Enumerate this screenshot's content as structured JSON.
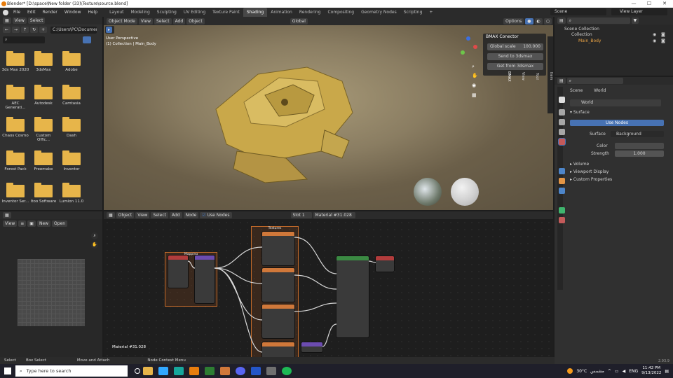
{
  "window": {
    "title": "Blender* [D:\\space\\New folder (33)\\Texture\\source.blend]",
    "min": "—",
    "max": "☐",
    "close": "✕"
  },
  "menu": [
    "File",
    "Edit",
    "Render",
    "Window",
    "Help"
  ],
  "workspaces": [
    "Layout",
    "Modeling",
    "Sculpting",
    "UV Editing",
    "Texture Paint",
    "Shading",
    "Animation",
    "Rendering",
    "Compositing",
    "Geometry Nodes",
    "Scripting",
    "+"
  ],
  "active_workspace": "Shading",
  "scene": {
    "label": "Scene",
    "view_layer": "View Layer"
  },
  "file_browser": {
    "path": "C:\\Users\\PC\\Documents\\",
    "folders": [
      "3ds Max 2020",
      "3dsMax",
      "Adobe",
      "AEC Generati...",
      "Autodesk",
      "Camtasia",
      "Chaos Cosmo",
      "Custom Offic...",
      "Dash",
      "Forest Pack",
      "Freemake",
      "Inventor",
      "Inventor Ser...",
      "Itoo Software",
      "Lumion 11.0"
    ]
  },
  "viewport": {
    "mode": "Object Mode",
    "menu": [
      "View",
      "Select",
      "Add",
      "Object"
    ],
    "perspective": "User Perspective",
    "collection_info": "(1) Collection | Main_Body",
    "transform": "Global",
    "options": "Options"
  },
  "bmax": {
    "title": "BMAX Conector",
    "global_scale_label": "Global scale",
    "global_scale_value": "100.000",
    "send": "Send to 3dsmax",
    "get": "Get from 3dsmax",
    "tabs": [
      "Item",
      "Tool",
      "View",
      "BMAX"
    ]
  },
  "outliner": {
    "root": "Scene Collection",
    "collection": "Collection",
    "object": "Main_Body"
  },
  "properties": {
    "scene_tab": "Scene",
    "world_tab": "World",
    "world_name": "World",
    "surface": "Surface",
    "use_nodes": "Use Nodes",
    "surface_label": "Surface",
    "surface_value": "Background",
    "color_label": "Color",
    "strength_label": "Strength",
    "strength_value": "1.000",
    "volume": "Volume",
    "viewport_display": "Viewport Display",
    "custom_properties": "Custom Properties",
    "version": "2.93.9"
  },
  "image_editor": {
    "view": "View",
    "new": "New",
    "open": "Open"
  },
  "node_editor": {
    "object": "Object",
    "menu": [
      "View",
      "Select",
      "Add",
      "Node"
    ],
    "use_nodes": "Use Nodes",
    "slot": "Slot 1",
    "material": "Material #31.028",
    "footer_material": "Material #31.028",
    "frames": [
      "Mapping",
      "Textures"
    ]
  },
  "statusbar": {
    "select": "Select",
    "box_select": "Box Select",
    "move": "Move and Attach",
    "context": "Node Context Menu"
  },
  "taskbar": {
    "search": "Type here to search",
    "weather": "30°C",
    "weather_desc": "مشمس",
    "lang": "ENG",
    "time": "11:42 PM",
    "date": "9/13/2022"
  },
  "colors": {
    "accent": "#4772b3",
    "folder": "#e7b54a",
    "frame": "#c46b2a",
    "texture_node": "#d0783a",
    "shader_node": "#3b8a43",
    "output_node": "#b23c3c",
    "mapping_node": "#6c4cb0"
  }
}
